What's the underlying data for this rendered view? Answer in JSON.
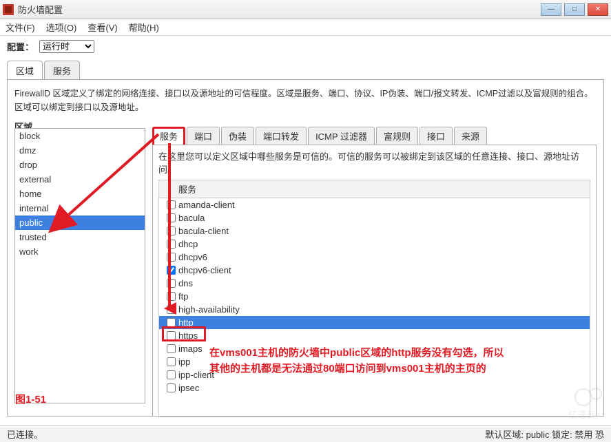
{
  "window": {
    "title": "防火墙配置",
    "min_icon": "—",
    "max_icon": "□",
    "close_icon": "✕"
  },
  "menu": {
    "file": "文件(F)",
    "options": "选项(O)",
    "view": "查看(V)",
    "help": "帮助(H)"
  },
  "config": {
    "label": "配置：",
    "selected": "运行时"
  },
  "outer_tabs": {
    "zone": "区域",
    "service": "服务"
  },
  "zone_desc": "FirewallD 区域定义了绑定的网络连接、接口以及源地址的可信程度。区域是服务、端口、协议、IP伪装、端口/报文转发、ICMP过滤以及富规则的组合。区域可以绑定到接口以及源地址。",
  "zone_header": "区域",
  "zones": [
    "block",
    "dmz",
    "drop",
    "external",
    "home",
    "internal",
    "public",
    "trusted",
    "work"
  ],
  "selected_zone": "public",
  "inner_tabs": [
    "服务",
    "端口",
    "伪装",
    "端口转发",
    "ICMP 过滤器",
    "富规则",
    "接口",
    "来源"
  ],
  "active_inner_tab": "服务",
  "inner_desc": "在这里您可以定义区域中哪些服务是可信的。可信的服务可以被绑定到该区域的任意连接、接口、源地址访问。",
  "service_header": "服务",
  "services": [
    {
      "name": "amanda-client",
      "checked": false
    },
    {
      "name": "bacula",
      "checked": false
    },
    {
      "name": "bacula-client",
      "checked": false
    },
    {
      "name": "dhcp",
      "checked": false
    },
    {
      "name": "dhcpv6",
      "checked": false
    },
    {
      "name": "dhcpv6-client",
      "checked": true
    },
    {
      "name": "dns",
      "checked": false
    },
    {
      "name": "ftp",
      "checked": false
    },
    {
      "name": "high-availability",
      "checked": false
    },
    {
      "name": "http",
      "checked": false,
      "selected": true
    },
    {
      "name": "https",
      "checked": false
    },
    {
      "name": "imaps",
      "checked": false
    },
    {
      "name": "ipp",
      "checked": false
    },
    {
      "name": "ipp-client",
      "checked": false
    },
    {
      "name": "ipsec",
      "checked": false
    }
  ],
  "annotation": {
    "line1": "在vms001主机的防火墙中public区域的http服务没有勾选，所以",
    "line2": "其他的主机都是无法通过80端口访问到vms001主机的主页的",
    "figure": "图1-51"
  },
  "status": {
    "left": "已连接。",
    "right": "默认区域:  public  锁定: 禁用  恐"
  },
  "watermark": "亿速云"
}
